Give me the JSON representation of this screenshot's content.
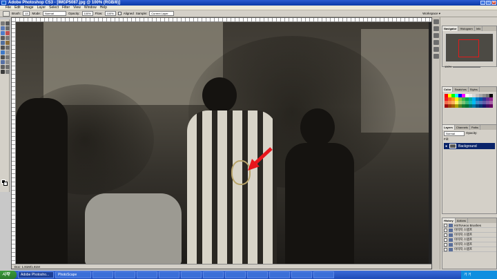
{
  "window": {
    "title": "Adobe Photoshop CS3 - [IMGP5087.jpg @ 100% (RGB/8)]"
  },
  "menu": [
    "File",
    "Edit",
    "Image",
    "Layer",
    "Select",
    "Filter",
    "View",
    "Window",
    "Help"
  ],
  "options": {
    "brush_label": "Brush:",
    "brush_size": "13",
    "mode_label": "Mode:",
    "mode_value": "Normal",
    "opacity_label": "Opacity:",
    "opacity_value": "100%",
    "flow_label": "Flow:",
    "flow_value": "100%",
    "aligned_label": "Aligned",
    "sample_label": "Sample:",
    "sample_value": "Current Layer",
    "workspace_label": "Workspace ▾"
  },
  "document": {
    "status": "Doc: 1.81M/1.81M"
  },
  "panels": {
    "navigator_tabs": [
      "Navigator",
      "Histogram",
      "Info"
    ],
    "navigator_zoom": "100%",
    "color_tabs": [
      "Color",
      "Swatches",
      "Styles"
    ],
    "layers_tabs": [
      "Layers",
      "Channels",
      "Paths"
    ],
    "layers_mode": "Normal",
    "layers_opacity_label": "Opacity:",
    "layers_fill_label": "Fill:",
    "layer_name": "Background",
    "history_tabs": [
      "History",
      "Actions"
    ],
    "history_items": [
      "HSTsAeoo Brushes",
      "이미지 스탬프",
      "이미지 스탬프",
      "이미지 스탬프",
      "이미지 스탬프",
      "이미지 스탬프"
    ]
  },
  "swatches": [
    "#ff0000",
    "#ffff00",
    "#00ff00",
    "#00ffff",
    "#0000ff",
    "#ff00ff",
    "#ffffff",
    "#ebebeb",
    "#d6d6d6",
    "#bfbfbf",
    "#a8a8a8",
    "#8f8f8f",
    "#757575",
    "#000000",
    "#ed1c24",
    "#f26522",
    "#f7941d",
    "#fff200",
    "#8dc63f",
    "#39b54a",
    "#00a651",
    "#00a99d",
    "#00aeef",
    "#0072bc",
    "#0054a6",
    "#2e3192",
    "#662d91",
    "#92278f",
    "#f26c4f",
    "#f68e55",
    "#fbaf5c",
    "#fff467",
    "#acd372",
    "#7cc576",
    "#3bb878",
    "#1abbb4",
    "#00bff3",
    "#438cca",
    "#5574b9",
    "#605ca8",
    "#855fa8",
    "#a763a8",
    "#9e0b0f",
    "#a0410d",
    "#a36209",
    "#aba000",
    "#598527",
    "#1a7b30",
    "#007236",
    "#00746b",
    "#0076a3",
    "#004b80",
    "#003471",
    "#1b1464",
    "#440e62",
    "#630460"
  ],
  "taskbar": {
    "start": "시작",
    "tasks": [
      "Adobe Photosho...",
      "PhotoScape",
      "",
      "",
      "",
      "",
      "",
      "",
      "",
      "",
      "",
      "",
      ""
    ],
    "clock": "가 거"
  }
}
